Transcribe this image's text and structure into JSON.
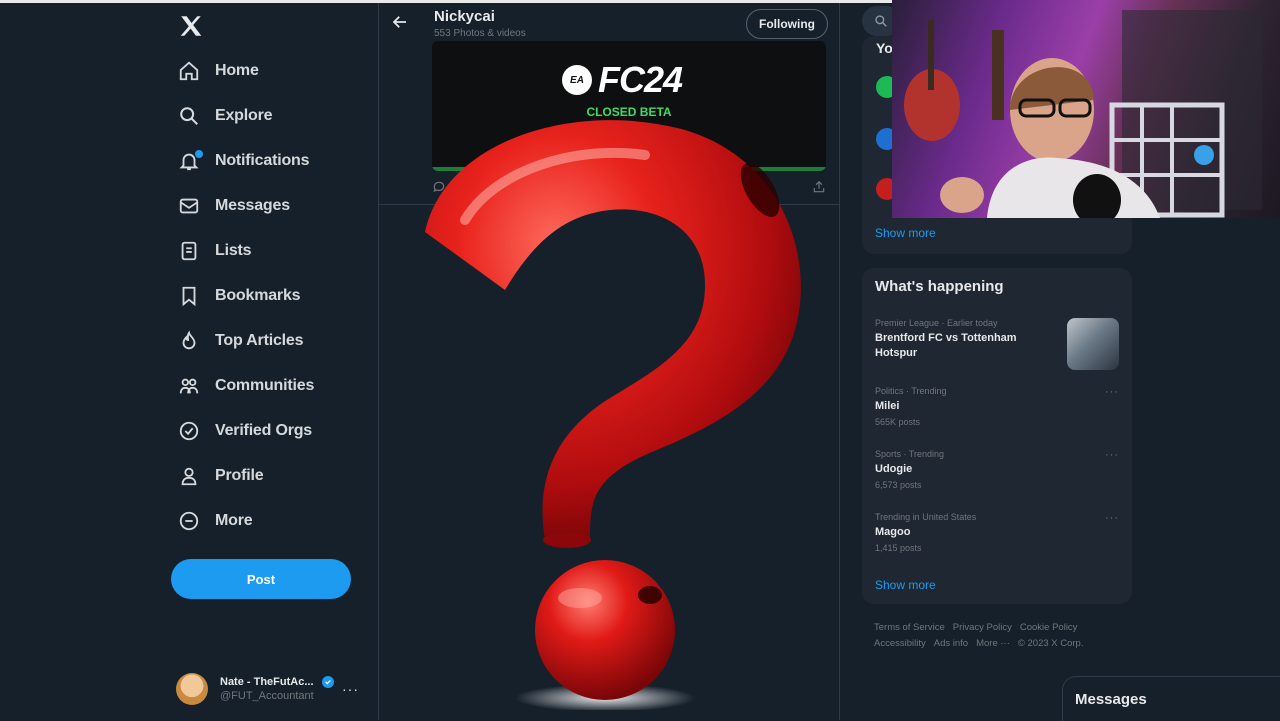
{
  "nav": {
    "logo_icon": "x-logo-icon",
    "items": [
      {
        "label": "Home",
        "icon": "home-icon"
      },
      {
        "label": "Explore",
        "icon": "search-icon"
      },
      {
        "label": "Notifications",
        "icon": "bell-icon"
      },
      {
        "label": "Messages",
        "icon": "envelope-icon"
      },
      {
        "label": "Lists",
        "icon": "list-icon"
      },
      {
        "label": "Bookmarks",
        "icon": "bookmark-icon"
      },
      {
        "label": "Top Articles",
        "icon": "flame-icon"
      },
      {
        "label": "Communities",
        "icon": "people-icon"
      },
      {
        "label": "Verified Orgs",
        "icon": "check-circle-icon"
      },
      {
        "label": "Profile",
        "icon": "person-icon"
      },
      {
        "label": "More",
        "icon": "more-circle-icon"
      }
    ],
    "post_label": "Post",
    "account": {
      "name": "Nate - TheFutAc...",
      "handle": "@FUT_Accountant"
    }
  },
  "profile": {
    "name": "Nickycai",
    "subtitle": "553 Photos & videos",
    "follow_label": "Following"
  },
  "media": {
    "logo_text": "FC24",
    "logo_badge": "EA",
    "caption": "CLOSED BETA"
  },
  "right": {
    "who_to_follow_title": "Yo",
    "show_more_1": "Show more",
    "happening_title": "What's happening",
    "trends": [
      {
        "category": "Premier League · Earlier today",
        "name": "Brentford FC vs Tottenham Hotspur",
        "posts": ""
      },
      {
        "category": "Politics · Trending",
        "name": "Milei",
        "posts": "565K posts"
      },
      {
        "category": "Sports · Trending",
        "name": "Udogie",
        "posts": "6,573 posts"
      },
      {
        "category": "Trending in United States",
        "name": "Magoo",
        "posts": "1,415 posts"
      }
    ],
    "show_more_2": "Show more",
    "footer": {
      "terms": "Terms of Service",
      "privacy": "Privacy Policy",
      "cookie": "Cookie Policy",
      "accessibility": "Accessibility",
      "ads": "Ads info",
      "more": "More ···",
      "copyright": "© 2023 X Corp."
    },
    "messages_title": "Messages"
  },
  "colors": {
    "background": "#15202b",
    "accent": "#1d9bf0",
    "question_mark": "#e0161a"
  }
}
